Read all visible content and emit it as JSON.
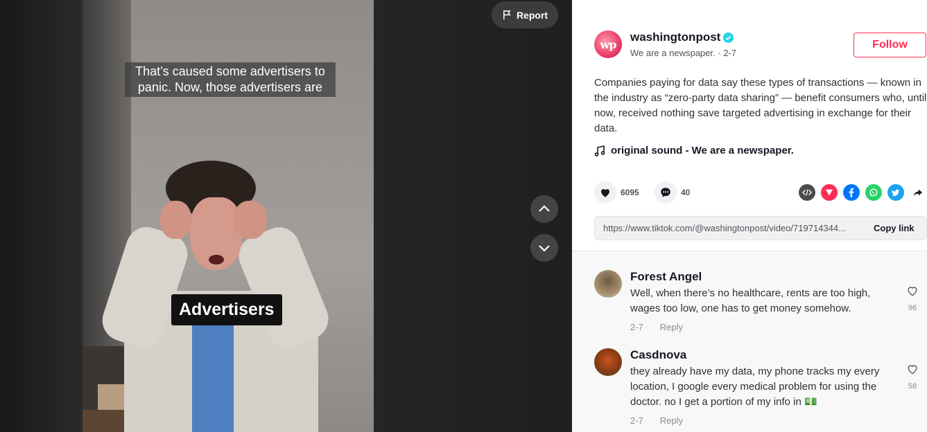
{
  "video": {
    "caption_top": "That’s caused some advertisers to panic. Now, those advertisers are",
    "caption_mid": "Advertisers",
    "report_label": "Report"
  },
  "author": {
    "logo_text": "wp",
    "username": "washingtonpost",
    "nickname": "We are a newspaper.",
    "date": "2-7",
    "follow_label": "Follow"
  },
  "post": {
    "description": "Companies paying for data say these types of transactions — known in the industry as “zero-party data sharing” — benefit consumers who, until now, received nothing save targeted advertising in exchange for their data.",
    "sound": "original sound - We are a newspaper.",
    "likes": "6095",
    "comments": "40",
    "link_url": "https://www.tiktok.com/@washingtonpost/video/719714344...",
    "copy_label": "Copy link"
  },
  "share_icons": [
    {
      "name": "embed-icon",
      "color": "#4c4c4c"
    },
    {
      "name": "send-to-friends-icon",
      "color": "#fe2c55"
    },
    {
      "name": "facebook-icon",
      "color": "#0075fa"
    },
    {
      "name": "whatsapp-icon",
      "color": "#25d366"
    },
    {
      "name": "twitter-icon",
      "color": "#1da1f2"
    }
  ],
  "comment_list": [
    {
      "name": "Forest Angel",
      "text": "Well, when there’s no healthcare, rents are too high, wages too low, one has to get money somehow.",
      "date": "2-7",
      "reply": "Reply",
      "likes": "96"
    },
    {
      "name": "Casdnova",
      "text": "they already have my data, my phone tracks my every location, I google every medical problem for using the doctor. no I get a portion of my info in 💵",
      "date": "2-7",
      "reply": "Reply",
      "likes": "58"
    }
  ]
}
